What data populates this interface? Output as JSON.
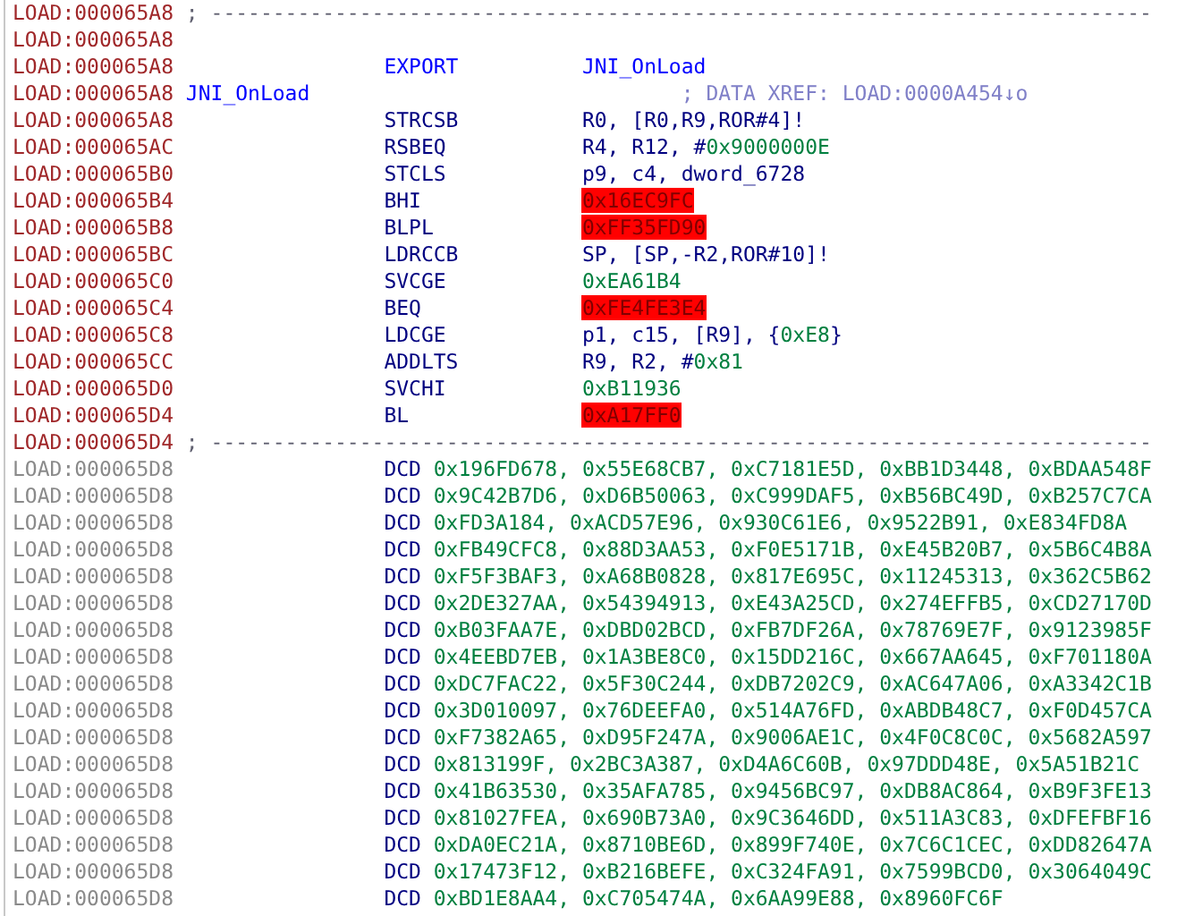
{
  "listing": {
    "rows": [
      {
        "kind": "separator",
        "address": "LOAD:000065A8",
        "text": "; ----------------------------------------------------------------------------"
      },
      {
        "kind": "blank",
        "address": "LOAD:000065A8"
      },
      {
        "kind": "directive",
        "address": "LOAD:000065A8",
        "mnemonic": "EXPORT",
        "operand": [
          {
            "kind": "name",
            "text": "JNI_OnLoad"
          }
        ]
      },
      {
        "kind": "label",
        "address": "LOAD:000065A8",
        "label": "JNI_OnLoad",
        "comment": "; DATA XREF: LOAD:0000A454↓o"
      },
      {
        "kind": "insn",
        "address": "LOAD:000065A8",
        "mnemonic": "STRCSB",
        "operand": [
          {
            "kind": "text",
            "text": "R0, [R0,R9,ROR#4]!"
          }
        ]
      },
      {
        "kind": "insn",
        "address": "LOAD:000065AC",
        "mnemonic": "RSBEQ",
        "operand": [
          {
            "kind": "text",
            "text": "R4, R12, #"
          },
          {
            "kind": "number",
            "text": "0x9000000E"
          }
        ]
      },
      {
        "kind": "insn",
        "address": "LOAD:000065B0",
        "mnemonic": "STCLS",
        "operand": [
          {
            "kind": "text",
            "text": "p9, c4, dword_6728"
          }
        ]
      },
      {
        "kind": "insn",
        "address": "LOAD:000065B4",
        "mnemonic": "BHI",
        "operand": [
          {
            "kind": "bad",
            "text": "0x16EC9FC"
          }
        ]
      },
      {
        "kind": "insn",
        "address": "LOAD:000065B8",
        "mnemonic": "BLPL",
        "operand": [
          {
            "kind": "bad",
            "text": "0xFF35FD90"
          }
        ]
      },
      {
        "kind": "insn",
        "address": "LOAD:000065BC",
        "mnemonic": "LDRCCB",
        "operand": [
          {
            "kind": "text",
            "text": "SP, [SP,-R2,ROR#10]!"
          }
        ]
      },
      {
        "kind": "insn",
        "address": "LOAD:000065C0",
        "mnemonic": "SVCGE",
        "operand": [
          {
            "kind": "number",
            "text": "0xEA61B4"
          }
        ]
      },
      {
        "kind": "insn",
        "address": "LOAD:000065C4",
        "mnemonic": "BEQ",
        "operand": [
          {
            "kind": "bad",
            "text": "0xFE4FE3E4"
          }
        ]
      },
      {
        "kind": "insn",
        "address": "LOAD:000065C8",
        "mnemonic": "LDCGE",
        "operand": [
          {
            "kind": "text",
            "text": "p1, c15, [R9], {"
          },
          {
            "kind": "number",
            "text": "0xE8"
          },
          {
            "kind": "text",
            "text": "}"
          }
        ]
      },
      {
        "kind": "insn",
        "address": "LOAD:000065CC",
        "mnemonic": "ADDLTS",
        "operand": [
          {
            "kind": "text",
            "text": "R9, R2, #"
          },
          {
            "kind": "number",
            "text": "0x81"
          }
        ]
      },
      {
        "kind": "insn",
        "address": "LOAD:000065D0",
        "mnemonic": "SVCHI",
        "operand": [
          {
            "kind": "number",
            "text": "0xB11936"
          }
        ]
      },
      {
        "kind": "insn",
        "address": "LOAD:000065D4",
        "mnemonic": "BL",
        "operand": [
          {
            "kind": "bad",
            "text": "0xA17FF0"
          }
        ]
      },
      {
        "kind": "separator",
        "address": "LOAD:000065D4",
        "text": "; ----------------------------------------------------------------------------"
      },
      {
        "kind": "data",
        "address": "LOAD:000065D8",
        "mnemonic": "DCD",
        "operand": [
          {
            "kind": "number",
            "text": "0x196FD678, 0x55E68CB7, 0xC7181E5D, 0xBB1D3448, 0xBDAA548F"
          }
        ]
      },
      {
        "kind": "data",
        "address": "LOAD:000065D8",
        "mnemonic": "DCD",
        "operand": [
          {
            "kind": "number",
            "text": "0x9C42B7D6, 0xD6B50063, 0xC999DAF5, 0xB56BC49D, 0xB257C7CA"
          }
        ]
      },
      {
        "kind": "data",
        "address": "LOAD:000065D8",
        "mnemonic": "DCD",
        "operand": [
          {
            "kind": "number",
            "text": "0xFD3A184, 0xACD57E96, 0x930C61E6, 0x9522B91, 0xE834FD8A"
          }
        ]
      },
      {
        "kind": "data",
        "address": "LOAD:000065D8",
        "mnemonic": "DCD",
        "operand": [
          {
            "kind": "number",
            "text": "0xFB49CFC8, 0x88D3AA53, 0xF0E5171B, 0xE45B20B7, 0x5B6C4B8A"
          }
        ]
      },
      {
        "kind": "data",
        "address": "LOAD:000065D8",
        "mnemonic": "DCD",
        "operand": [
          {
            "kind": "number",
            "text": "0xF5F3BAF3, 0xA68B0828, 0x817E695C, 0x11245313, 0x362C5B62"
          }
        ]
      },
      {
        "kind": "data",
        "address": "LOAD:000065D8",
        "mnemonic": "DCD",
        "operand": [
          {
            "kind": "number",
            "text": "0x2DE327AA, 0x54394913, 0xE43A25CD, 0x274EFFB5, 0xCD27170D"
          }
        ]
      },
      {
        "kind": "data",
        "address": "LOAD:000065D8",
        "mnemonic": "DCD",
        "operand": [
          {
            "kind": "number",
            "text": "0xB03FAA7E, 0xDBD02BCD, 0xFB7DF26A, 0x78769E7F, 0x9123985F"
          }
        ]
      },
      {
        "kind": "data",
        "address": "LOAD:000065D8",
        "mnemonic": "DCD",
        "operand": [
          {
            "kind": "number",
            "text": "0x4EEBD7EB, 0x1A3BE8C0, 0x15DD216C, 0x667AA645, 0xF701180A"
          }
        ]
      },
      {
        "kind": "data",
        "address": "LOAD:000065D8",
        "mnemonic": "DCD",
        "operand": [
          {
            "kind": "number",
            "text": "0xDC7FAC22, 0x5F30C244, 0xDB7202C9, 0xAC647A06, 0xA3342C1B"
          }
        ]
      },
      {
        "kind": "data",
        "address": "LOAD:000065D8",
        "mnemonic": "DCD",
        "operand": [
          {
            "kind": "number",
            "text": "0x3D010097, 0x76DEEFA0, 0x514A76FD, 0xABDB48C7, 0xF0D457CA"
          }
        ]
      },
      {
        "kind": "data",
        "address": "LOAD:000065D8",
        "mnemonic": "DCD",
        "operand": [
          {
            "kind": "number",
            "text": "0xF7382A65, 0xD95F247A, 0x9006AE1C, 0x4F0C8C0C, 0x5682A597"
          }
        ]
      },
      {
        "kind": "data",
        "address": "LOAD:000065D8",
        "mnemonic": "DCD",
        "operand": [
          {
            "kind": "number",
            "text": "0x813199F, 0x2BC3A387, 0xD4A6C60B, 0x97DDD48E, 0x5A51B21C"
          }
        ]
      },
      {
        "kind": "data",
        "address": "LOAD:000065D8",
        "mnemonic": "DCD",
        "operand": [
          {
            "kind": "number",
            "text": "0x41B63530, 0x35AFA785, 0x9456BC97, 0xDB8AC864, 0xB9F3FE13"
          }
        ]
      },
      {
        "kind": "data",
        "address": "LOAD:000065D8",
        "mnemonic": "DCD",
        "operand": [
          {
            "kind": "number",
            "text": "0x81027FEA, 0x690B73A0, 0x9C3646DD, 0x511A3C83, 0xDFEFBF16"
          }
        ]
      },
      {
        "kind": "data",
        "address": "LOAD:000065D8",
        "mnemonic": "DCD",
        "operand": [
          {
            "kind": "number",
            "text": "0xDA0EC21A, 0x8710BE6D, 0x899F740E, 0x7C6C1CEC, 0xDD82647A"
          }
        ]
      },
      {
        "kind": "data",
        "address": "LOAD:000065D8",
        "mnemonic": "DCD",
        "operand": [
          {
            "kind": "number",
            "text": "0x17473F12, 0xB216BEFE, 0xC324FA91, 0x7599BCD0, 0x3064049C"
          }
        ]
      },
      {
        "kind": "data",
        "address": "LOAD:000065D8",
        "mnemonic": "DCD",
        "operand": [
          {
            "kind": "number",
            "text": "0xBD1E8AA4, 0xC705474A, 0x6AA99E88, 0x8960FC6F"
          }
        ]
      }
    ]
  }
}
